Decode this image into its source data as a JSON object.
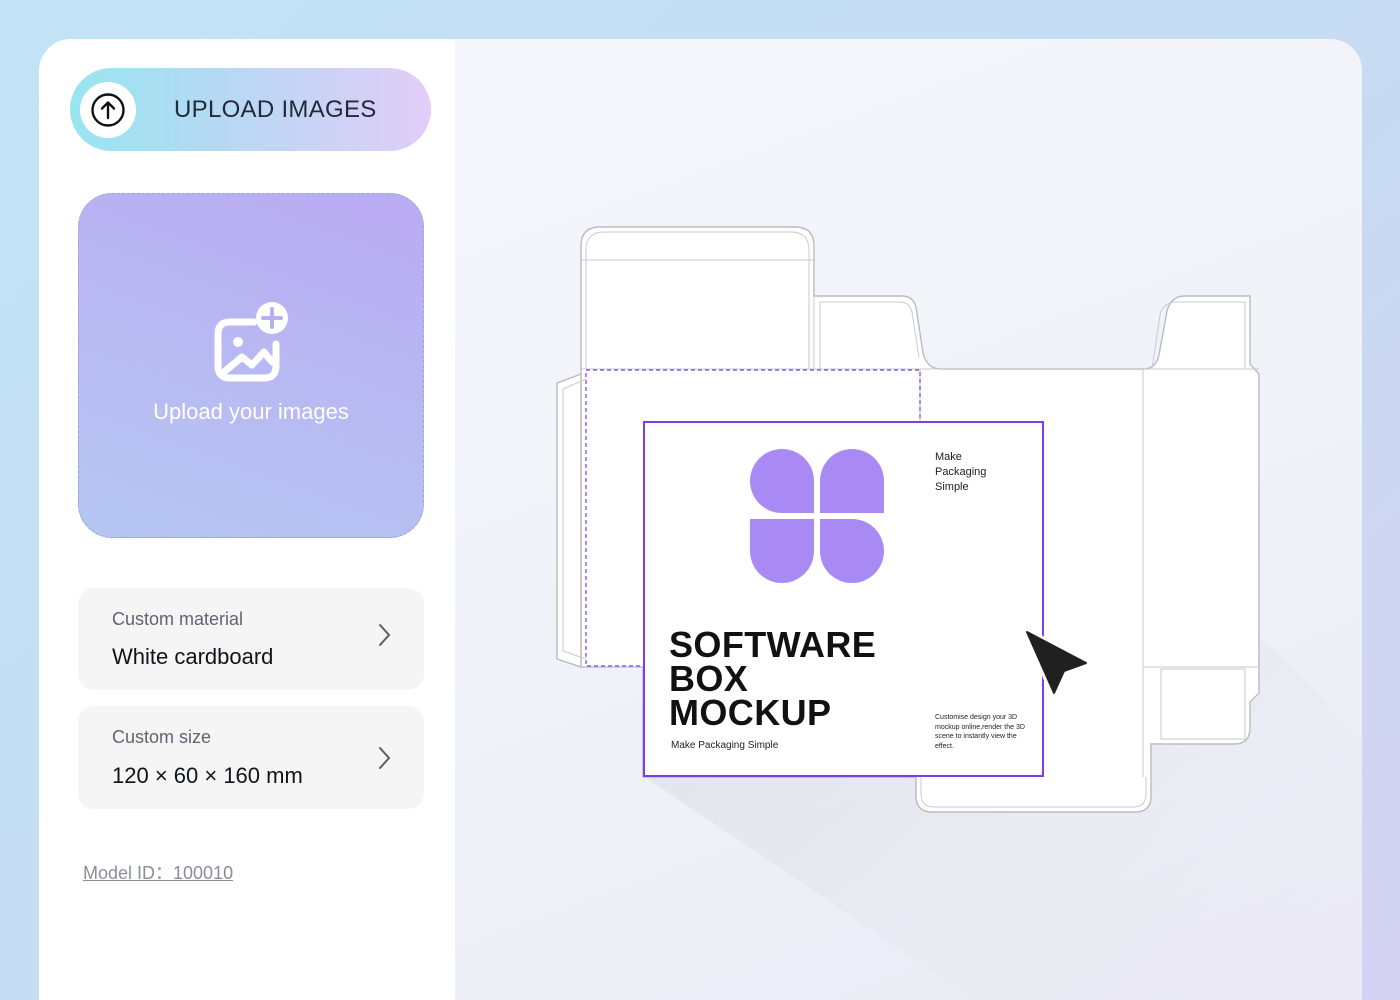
{
  "sidebar": {
    "upload_button": {
      "label": "UPLOAD IMAGES",
      "icon": "arrow-up-circle-icon"
    },
    "dropzone": {
      "text": "Upload your images",
      "icon": "image-add-icon"
    },
    "material": {
      "caption": "Custom material",
      "value": "White cardboard"
    },
    "size": {
      "caption": "Custom size",
      "value": "120 × 60 × 160 mm"
    },
    "model_id": "Model ID：100010"
  },
  "preview": {
    "box_front": {
      "side_text": [
        "Make",
        "Packaging",
        "Simple"
      ],
      "title_lines": [
        "SOFTWARE",
        "BOX",
        "MOCKUP"
      ],
      "tagline": "Make Packaging Simple",
      "description": "Customise design your 3D mockup online,render the 3D scene to instantly view the effect."
    },
    "accent_color": "#7d3cf0",
    "logo_color": "#a98af5"
  }
}
